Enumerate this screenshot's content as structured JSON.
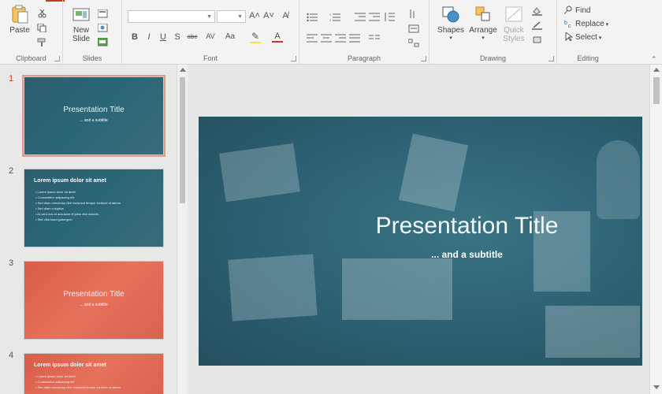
{
  "ribbon": {
    "clipboard": {
      "paste_label": "Paste",
      "group_label": "Clipboard"
    },
    "slides": {
      "new_slide_label": "New",
      "new_slide_label2": "Slide",
      "group_label": "Slides"
    },
    "font": {
      "group_label": "Font",
      "font_name_value": "",
      "font_size_value": "",
      "grow_label": "A˄",
      "shrink_label": "A˅",
      "clear_label": "A̸",
      "bold": "B",
      "italic": "I",
      "underline": "U",
      "shadow": "S",
      "strike": "abc",
      "spacing": "AV",
      "case": "Aa",
      "highlight": "✎",
      "color": "A"
    },
    "paragraph": {
      "group_label": "Paragraph"
    },
    "drawing": {
      "group_label": "Drawing",
      "shapes_label": "Shapes",
      "arrange_label": "Arrange",
      "quick_styles_label": "Quick",
      "quick_styles_label2": "Styles"
    },
    "editing": {
      "group_label": "Editing",
      "find_label": "Find",
      "replace_label": "Replace",
      "select_label": "Select"
    }
  },
  "thumbnails": [
    {
      "number": "1",
      "title": "Presentation Title",
      "subtitle": "... and a subtitle"
    },
    {
      "number": "2",
      "heading": "Lorem ipsum dolor sit amet",
      "bullets": [
        "Lorem ipsum dolor sit amet",
        "Consectetur adipiscing elit",
        "Sed diam nonummy nibh euismod tempor incidunt ut labore",
        "Sed diam voluptua",
        "At vero eos et accusam et justo duo dolores",
        "Stet clita kasd gubergren"
      ]
    },
    {
      "number": "3",
      "title": "Presentation Title",
      "subtitle": "... and a subtitle"
    },
    {
      "number": "4",
      "heading": "Lorem ipsum dolor sit amet",
      "bullets": [
        "Lorem ipsum dolor sit amet",
        "Consectetur adipiscing elit",
        "Sed diam nonummy nibh euismod tempor incidunt ut labore"
      ]
    }
  ],
  "slide": {
    "title": "Presentation Title",
    "subtitle": "... and a subtitle"
  },
  "colors": {
    "accent": "#c43e1c",
    "slide_teal": "#2c6071",
    "slide_coral": "#e2644f"
  },
  "icons": [
    "paste-icon",
    "cut-icon",
    "copy-icon",
    "format-painter-icon",
    "new-slide-icon",
    "layout-icon",
    "reset-icon",
    "section-icon",
    "shapes-icon",
    "arrange-icon",
    "quick-styles-icon",
    "find-icon",
    "replace-icon",
    "select-icon"
  ]
}
